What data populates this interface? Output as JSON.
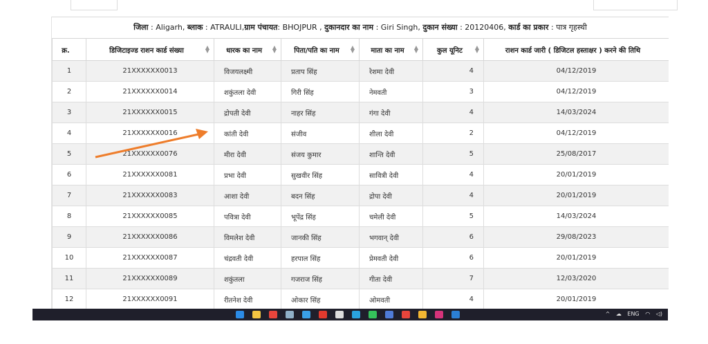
{
  "caption": {
    "district_label": "जिला",
    "district": "Aligarh",
    "block_label": "ब्लाक",
    "block": "ATRAULI",
    "panchayat_label": "ग्राम पंचायत",
    "panchayat": "BHOJPUR",
    "dealer_label": "दुकानदार का नाम",
    "dealer": "Giri Singh",
    "shop_label": "दुकान संख्या",
    "shop": "20120406",
    "card_type_label": "कार्ड का प्रकार",
    "card_type": "पात्र गृहस्थी"
  },
  "table": {
    "headers": [
      "क्र.",
      "डिजिटाइज्ड राशन कार्ड संख्या",
      "धारक का नाम",
      "पिता/पति का नाम",
      "माता का नाम",
      "कुल यूनिट",
      "राशन कार्ड जारी ( डिजिटल हस्ताक्षर ) करने की तिथि"
    ],
    "rows": [
      {
        "no": "1",
        "card": "21XXXXXX0013",
        "holder": "विजयलक्ष्मी",
        "father": "प्रताप सिंह",
        "mother": "रेशमा देवी",
        "units": "4",
        "date": "04/12/2019"
      },
      {
        "no": "2",
        "card": "21XXXXXX0014",
        "holder": "शकुंतला देवी",
        "father": "गिरी सिंह",
        "mother": "नेमवती",
        "units": "3",
        "date": "04/12/2019"
      },
      {
        "no": "3",
        "card": "21XXXXXX0015",
        "holder": "द्रोपती देवी",
        "father": "नाहर सिंह",
        "mother": "गंगा देवी",
        "units": "4",
        "date": "14/03/2024"
      },
      {
        "no": "4",
        "card": "21XXXXXX0016",
        "holder": "कांती देवी",
        "father": "संजीव",
        "mother": "शीला देवी",
        "units": "2",
        "date": "04/12/2019"
      },
      {
        "no": "5",
        "card": "21XXXXXX0076",
        "holder": "मीरा देवी",
        "father": "संजय कुमार",
        "mother": "शान्ति देवी",
        "units": "5",
        "date": "25/08/2017"
      },
      {
        "no": "6",
        "card": "21XXXXXX0081",
        "holder": "प्रभा देवी",
        "father": "सुखवीर सिंह",
        "mother": "सावित्री देवी",
        "units": "4",
        "date": "20/01/2019"
      },
      {
        "no": "7",
        "card": "21XXXXXX0083",
        "holder": "आशा देवी",
        "father": "बदन सिंह",
        "mother": "द्रोपा देवी",
        "units": "4",
        "date": "20/01/2019"
      },
      {
        "no": "8",
        "card": "21XXXXXX0085",
        "holder": "पवित्रा देवी",
        "father": "भूपेंद्र सिंह",
        "mother": "चमेली देवी",
        "units": "5",
        "date": "14/03/2024"
      },
      {
        "no": "9",
        "card": "21XXXXXX0086",
        "holder": "विमलेश देवी",
        "father": "जानकी सिंह",
        "mother": "भगवान् देवी",
        "units": "6",
        "date": "29/08/2023"
      },
      {
        "no": "10",
        "card": "21XXXXXX0087",
        "holder": "चंद्रवती देवी",
        "father": "हरपाल सिंह",
        "mother": "प्रेमवती देवी",
        "units": "6",
        "date": "20/01/2019"
      },
      {
        "no": "11",
        "card": "21XXXXXX0089",
        "holder": "शकुंतला",
        "father": "गजराज सिंह",
        "mother": "गीता देवी",
        "units": "7",
        "date": "12/03/2020"
      },
      {
        "no": "12",
        "card": "21XXXXXX0091",
        "holder": "रीतनेश देवी",
        "father": "ओकार सिंह",
        "mother": "ओमवती",
        "units": "4",
        "date": "20/01/2019"
      }
    ]
  },
  "annotation": {
    "color": "#ee7d2b"
  },
  "taskbar": {
    "icons": [
      "windows-icon",
      "file-explorer-icon",
      "chrome-icon",
      "calculator-icon",
      "edge-icon",
      "youtube-icon",
      "x-icon",
      "telegram-icon",
      "download-icon",
      "notepad-icon",
      "chrome-alt-icon",
      "folder-icon",
      "instagram-icon",
      "vscode-icon"
    ],
    "language": "ENG"
  }
}
